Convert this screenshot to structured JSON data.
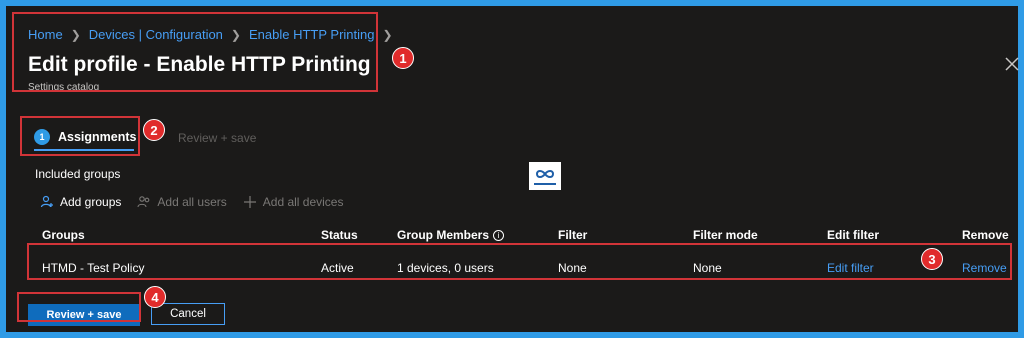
{
  "breadcrumb": {
    "items": [
      "Home",
      "Devices | Configuration",
      "Enable HTTP Printing"
    ]
  },
  "header": {
    "title": "Edit profile - Enable HTTP Printing",
    "subtitle": "Settings catalog"
  },
  "wizard": {
    "steps": [
      {
        "number": "1",
        "label": "Assignments",
        "active": true
      },
      {
        "label": "Review + save",
        "active": false
      }
    ]
  },
  "section": {
    "title": "Included groups"
  },
  "toolbar": {
    "add_groups": "Add groups",
    "add_all_users": "Add all users",
    "add_all_devices": "Add all devices"
  },
  "table": {
    "columns": [
      "Groups",
      "Status",
      "Group Members",
      "Filter",
      "Filter mode",
      "Edit filter",
      "Remove"
    ],
    "rows": [
      {
        "group": "HTMD - Test Policy",
        "status": "Active",
        "members": "1 devices, 0 users",
        "filter": "None",
        "filter_mode": "None",
        "edit_filter": "Edit filter",
        "remove": "Remove"
      }
    ]
  },
  "footer": {
    "primary": "Review + save",
    "secondary": "Cancel"
  },
  "callouts": [
    "1",
    "2",
    "3",
    "4"
  ],
  "colors": {
    "accent": "#2f9be6",
    "link": "#479ef5",
    "highlight": "#d13438",
    "background": "#1b1a19"
  },
  "icons": {
    "close": "close-icon",
    "add_group": "person-add-icon",
    "add_users": "people-add-icon",
    "add_devices": "plus-icon",
    "info": "info-icon"
  }
}
